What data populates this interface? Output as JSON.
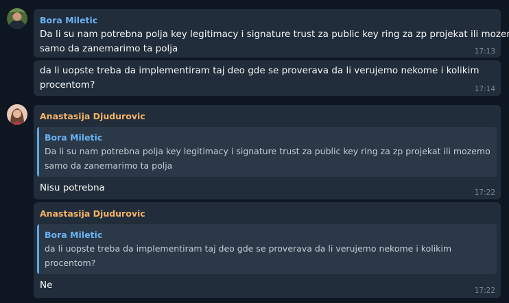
{
  "messages": [
    {
      "sender": "Bora Miletic",
      "lines": [
        "Da li su nam potrebna polja key legitimacy i signature trust za public key ring za zp projekat ili mozemo",
        "samo da zanemarimo ta polja"
      ],
      "time": "17:13"
    },
    {
      "lines": [
        "da li uopste treba da implementiram taj deo gde se proverava da li verujemo nekome i kolikim",
        "procentom?"
      ],
      "time": "17:14"
    },
    {
      "sender": "Anastasija Djudurovic",
      "reply": {
        "sender": "Bora Miletic",
        "lines": [
          "Da li su nam potrebna polja key legitimacy i signature trust za public key ring za zp projekat ili mozemo",
          "samo da zanemarimo ta polja"
        ]
      },
      "text": "Nisu potrebna",
      "time": "17:22"
    },
    {
      "sender": "Anastasija Djudurovic",
      "reply": {
        "sender": "Bora Miletic",
        "lines": [
          "da li uopste treba da implementiram taj deo gde se proverava da li verujemo nekome i kolikim",
          "procentom?"
        ]
      },
      "text": "Ne",
      "time": "17:22"
    }
  ],
  "colors": {
    "background": "#0e1621",
    "bubble": "#212d3b",
    "quote_background": "#2a3848",
    "sender_bora": "#6ab3f3",
    "sender_anastasija": "#f5b366",
    "timestamp": "#7d8b99"
  }
}
